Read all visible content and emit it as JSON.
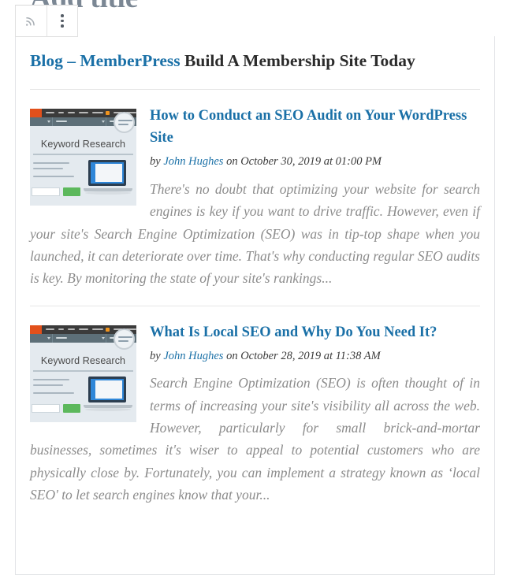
{
  "editor": {
    "post_title_placeholder": "Add title"
  },
  "toolbar": {
    "items": [
      {
        "icon": "rss-icon",
        "label": "RSS"
      },
      {
        "icon": "more-options-icon",
        "label": "More options"
      }
    ]
  },
  "rss_block": {
    "feed_title": "Blog – MemberPress",
    "feed_description": "Build A Membership Site Today",
    "items": [
      {
        "title": "How to Conduct an SEO Audit on Your WordPress Site",
        "by_label": "by",
        "author": "John Hughes",
        "on_label": "on",
        "date": "October 30, 2019",
        "at_label": "at",
        "time": "01:00 PM",
        "excerpt": "There's no doubt that optimizing your website for search engines is key if you want to drive traffic. However, even if your site's Search Engine Optimization (SEO) was in tip-top shape when you launched, it can deteriorate over time. That's why conducting regular SEO audits is key. By monitoring the state of your site's rankings...",
        "thumbnail": {
          "heading": "Keyword Research",
          "logo_color": "#e2501b",
          "navbar_color": "#3b3b3b",
          "subbar_color": "#5d6f78",
          "background_color": "#e4eaef",
          "button_color": "#5cb85c"
        }
      },
      {
        "title": "What Is Local SEO and Why Do You Need It?",
        "by_label": "by",
        "author": "John Hughes",
        "on_label": "on",
        "date": "October 28, 2019",
        "at_label": "at",
        "time": "11:38 AM",
        "excerpt": "Search Engine Optimization (SEO) is often thought of in terms of increasing your site's visibility all across the web. However, particularly for small brick-and-mortar businesses, sometimes it's wiser to appeal to potential customers who are physically close by. Fortunately, you can implement a strategy known as ‘local SEO' to let search engines know that your...",
        "thumbnail": {
          "heading": "Keyword Research",
          "logo_color": "#e2501b",
          "navbar_color": "#3b3b3b",
          "subbar_color": "#5d6f78",
          "background_color": "#e4eaef",
          "button_color": "#5cb85c"
        }
      }
    ]
  },
  "colors": {
    "link": "#1a70a7",
    "text": "#2b2b2b",
    "muted": "#8c8c8c",
    "border": "#e2e4e7"
  }
}
